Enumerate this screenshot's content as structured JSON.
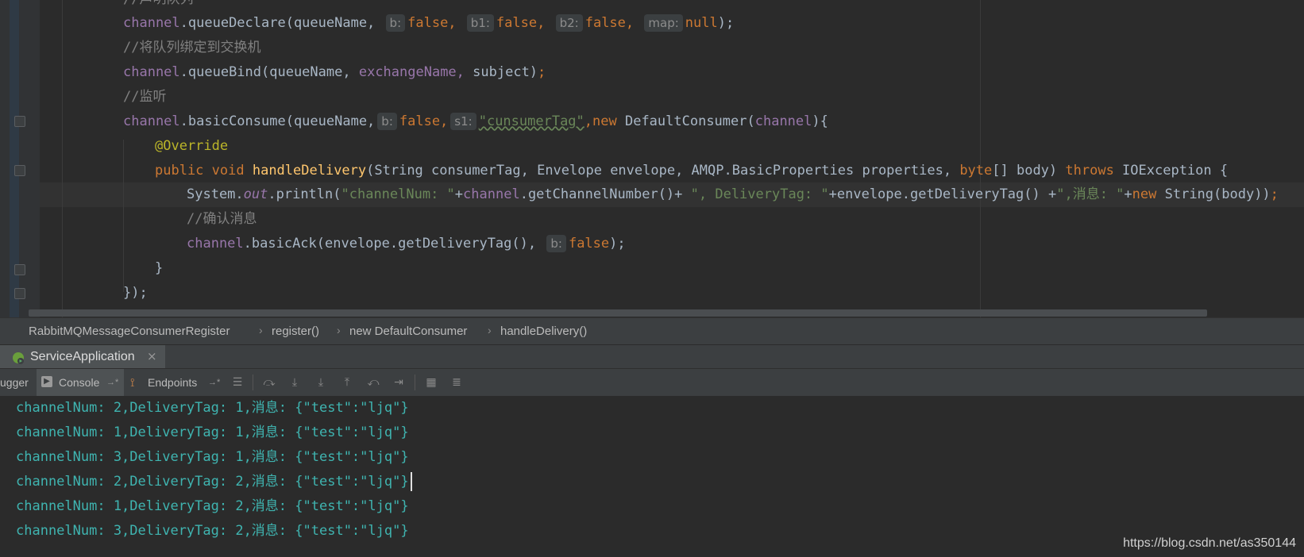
{
  "editor": {
    "lines": {
      "l0": "//声明队列",
      "l1_obj": "channel",
      "l1_call": ".queueDeclare(queueName,",
      "l1_h1": "b:",
      "l1_v1": "false,",
      "l1_h2": "b1:",
      "l1_v2": "false,",
      "l1_h3": "b2:",
      "l1_v3": "false,",
      "l1_h4": "map:",
      "l1_v4": "null",
      "l1_end": ");",
      "l2": "//将队列绑定到交换机",
      "l3_obj": "channel",
      "l3_call": ".queueBind(queueName,",
      "l3_arg": "exchangeName,",
      "l3_rest": "subject)",
      "l3_end": ";",
      "l4": "//监听",
      "l5_obj": "channel",
      "l5_call": ".basicConsume(queueName,",
      "l5_h1": "b:",
      "l5_v1": "false,",
      "l5_h2": "s1:",
      "l5_s": "\"cunsumerTag\"",
      "l5_new": ",new",
      "l5_cls": " DefaultConsumer(",
      "l5_arg": "channel",
      "l5_end": "){",
      "l6": "@Override",
      "l7_mod": "public void",
      "l7_name": "handleDelivery",
      "l7_params1": "(String consumerTag,",
      "l7_params2": " Envelope envelope,",
      "l7_params3": " AMQP.BasicProperties properties,",
      "l7_byte": " byte",
      "l7_params4": "[] body)",
      "l7_throws": " throws",
      "l7_exc": " IOException {",
      "l8_sys": "System.",
      "l8_out": "out",
      "l8_print": ".println(",
      "l8_s1": "\"channelNum: \"",
      "l8_plus1": "+",
      "l8_ch": "channel",
      "l8_call1": ".getChannelNumber()+ ",
      "l8_s2": "\", DeliveryTag: \"",
      "l8_plus2": "+envelope.getDeliveryTag() +",
      "l8_s3": "\",消息: \"",
      "l8_plus3": "+",
      "l8_new": "new",
      "l8_str": " String(body))",
      "l8_end": ";",
      "l9": "//确认消息",
      "l10_obj": "channel",
      "l10_call": ".basicAck(envelope.getDeliveryTag(),",
      "l10_h1": "b:",
      "l10_v1": "false",
      "l10_end": ");",
      "l11": "}",
      "l12": "});"
    }
  },
  "breadcrumb": {
    "items": [
      "RabbitMQMessageConsumerRegister",
      "register()",
      "new DefaultConsumer",
      "handleDelivery()"
    ],
    "sep": "›"
  },
  "run_panel": {
    "tab_label": "ServiceApplication",
    "close_glyph": "×"
  },
  "toolbar": {
    "debugger_label": "ugger",
    "console_label": "Console",
    "endpoints_label": "Endpoints",
    "pin_glyph": "→*"
  },
  "console": {
    "lines": [
      "channelNum: 2,DeliveryTag: 1,消息: {\"test\":\"ljq\"}",
      "channelNum: 1,DeliveryTag: 1,消息: {\"test\":\"ljq\"}",
      "channelNum: 3,DeliveryTag: 1,消息: {\"test\":\"ljq\"}",
      "channelNum: 2,DeliveryTag: 2,消息: {\"test\":\"ljq\"}",
      "channelNum: 1,DeliveryTag: 2,消息: {\"test\":\"ljq\"}",
      "channelNum: 3,DeliveryTag: 2,消息: {\"test\":\"ljq\"}"
    ]
  },
  "watermark": "https://blog.csdn.net/as350144",
  "colors": {
    "keyword": "#cc7832",
    "field": "#9876aa",
    "string": "#6a8759",
    "comment": "#808080",
    "annotation": "#bbb529",
    "method": "#ffc66d",
    "console_text": "#3fb4b0"
  }
}
